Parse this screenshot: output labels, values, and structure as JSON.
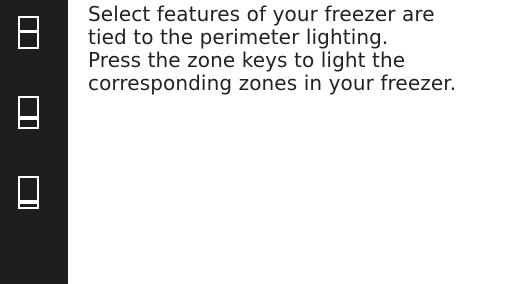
{
  "zone_keys": [
    {
      "icon": "zone-top-icon"
    },
    {
      "icon": "zone-middle-icon"
    },
    {
      "icon": "zone-bottom-icon"
    }
  ],
  "description": {
    "lines": [
      "Select features of your freezer are",
      "tied to the perimeter lighting.",
      "Press the zone keys to light the",
      "corresponding zones in your freezer."
    ]
  },
  "colors": {
    "panel": "#1e1e1e",
    "icon": "#ffffff",
    "text": "#222222"
  }
}
